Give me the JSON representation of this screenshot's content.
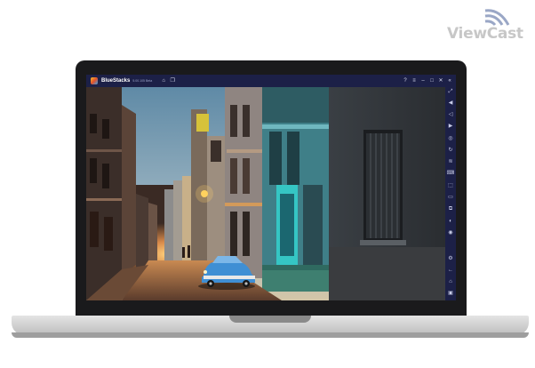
{
  "watermark": {
    "brand": "ViewCast",
    "icon": "wifi-signal-icon"
  },
  "emulator": {
    "app_name": "BlueStacks",
    "version": "5.00.105 Beta",
    "title_left_icons": [
      "home-icon",
      "multi-instance-icon"
    ],
    "title_right_icons": [
      {
        "name": "help-icon",
        "glyph": "?"
      },
      {
        "name": "menu-icon",
        "glyph": "≡"
      },
      {
        "name": "minimize-icon",
        "glyph": "–"
      },
      {
        "name": "maximize-icon",
        "glyph": "□"
      },
      {
        "name": "close-icon",
        "glyph": "✕"
      },
      {
        "name": "collapse-sidebar-icon",
        "glyph": "«"
      }
    ],
    "sidebar_icons": [
      "fullscreen-icon",
      "volume-up-icon",
      "volume-down-icon",
      "media-icon",
      "lock-cursor-icon",
      "rotate-icon",
      "shake-icon",
      "controls-icon",
      "screenshot-icon",
      "folder-icon",
      "multi-instance-sync-icon",
      "eco-mode-icon",
      "location-icon",
      "settings-icon",
      "back-icon",
      "home-nav-icon",
      "recent-apps-icon"
    ]
  },
  "colors": {
    "titlebar_bg": "#1c2047",
    "bezel": "#1a1a1c",
    "car": "#3f8fd4",
    "street_glow": "#f0a24a",
    "sky": "#7fa0b8"
  }
}
